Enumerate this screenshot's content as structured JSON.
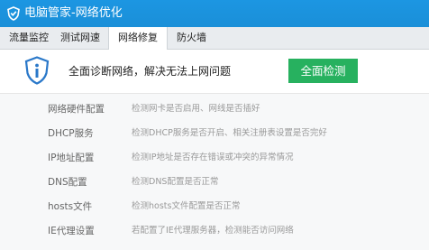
{
  "window": {
    "title": "电脑管家-网络优化"
  },
  "tabs": [
    {
      "label": "流量监控"
    },
    {
      "label": "测试网速"
    },
    {
      "label": "网络修复"
    },
    {
      "label": "防火墙"
    }
  ],
  "hero": {
    "message": "全面诊断网络，解决无法上网问题",
    "button_label": "全面检测",
    "icon": "shield-info-icon"
  },
  "checks": [
    {
      "name": "网络硬件配置",
      "desc": "检测网卡是否启用、网线是否插好"
    },
    {
      "name": "DHCP服务",
      "desc": "检测DHCP服务是否开启、相关注册表设置是否完好"
    },
    {
      "name": "IP地址配置",
      "desc": "检测IP地址是否存在错误或冲突的异常情况"
    },
    {
      "name": "DNS配置",
      "desc": "检测DNS配置是否正常"
    },
    {
      "name": "hosts文件",
      "desc": "检测hosts文件配置是否正常"
    },
    {
      "name": "IE代理设置",
      "desc": "若配置了IE代理服务器，检测能否访问网络"
    }
  ],
  "colors": {
    "titlebar": "#1a8fd8",
    "accent_green": "#27b15f",
    "shield": "#2a78c9"
  }
}
